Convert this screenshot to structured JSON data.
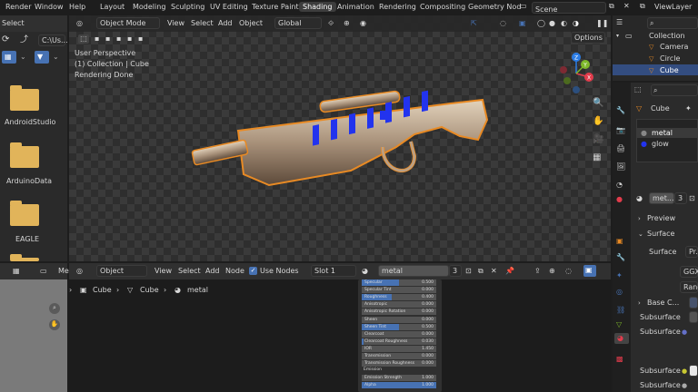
{
  "topbar": {
    "menus": [
      "Render",
      "Window",
      "Help"
    ],
    "workspaces": [
      "Layout",
      "Modeling",
      "Sculpting",
      "UV Editing",
      "Texture Paint",
      "Shading",
      "Animation",
      "Rendering",
      "Compositing",
      "Geometry Nod"
    ],
    "scene": "Scene",
    "view_layer": "ViewLayer"
  },
  "filebrowser": {
    "select_label": "Select",
    "path": "C:\\Us...",
    "folders": [
      "AndroidStudio",
      "ArduinoData",
      "EAGLE"
    ]
  },
  "viewport": {
    "mode": "Object Mode",
    "menus": [
      "View",
      "Select",
      "Add",
      "Object"
    ],
    "transform": "Global",
    "options": "Options",
    "info_line1": "User Perspective",
    "info_line2": "(1) Collection | Cube",
    "info_line3": "Rendering Done",
    "gizmo_axes": [
      "X",
      "Y",
      "Z"
    ]
  },
  "outliner": {
    "root": "Collection",
    "items": [
      "Camera",
      "Circle",
      "Cube"
    ]
  },
  "properties": {
    "object_name": "Cube",
    "materials": [
      "metal",
      "glow"
    ],
    "material_name": "met...",
    "user_count": "3",
    "preview": "Preview",
    "surface": "Surface",
    "surface_label": "Surface",
    "surface_value": "Pr...",
    "ggx": "GGX",
    "random": "Rand...",
    "base_color": "Base C...",
    "subsurface_rows": [
      "Subsurface",
      "Subsurface",
      "Subsurface",
      "Subsurface"
    ]
  },
  "node_editor": {
    "header_partial": "Me",
    "mode": "Object",
    "menus": [
      "View",
      "Select",
      "Add",
      "Node"
    ],
    "use_nodes": "Use Nodes",
    "slot": "Slot 1",
    "material": "metal",
    "users": "3",
    "breadcrumb": [
      "Cube",
      "Cube",
      "metal"
    ],
    "bsdf_params": [
      {
        "label": "Specular",
        "value": "0.500",
        "fill": 0.5
      },
      {
        "label": "Specular Tint",
        "value": "0.000",
        "fill": 0
      },
      {
        "label": "Roughness",
        "value": "0.400",
        "fill": 0.4
      },
      {
        "label": "Anisotropic",
        "value": "0.000",
        "fill": 0
      },
      {
        "label": "Anisotropic Rotation",
        "value": "0.000",
        "fill": 0
      },
      {
        "label": "Sheen",
        "value": "0.000",
        "fill": 0
      },
      {
        "label": "Sheen Tint",
        "value": "0.500",
        "fill": 0.5
      },
      {
        "label": "Clearcoat",
        "value": "0.000",
        "fill": 0
      },
      {
        "label": "Clearcoat Roughness",
        "value": "0.030",
        "fill": 0.03
      },
      {
        "label": "IOR",
        "value": "1.450",
        "fill": 0
      },
      {
        "label": "Transmission",
        "value": "0.000",
        "fill": 0
      },
      {
        "label": "Transmission Roughness",
        "value": "0.000",
        "fill": 0
      }
    ],
    "emission_label": "Emission",
    "emission_strength_label": "Emission Strength",
    "emission_strength_value": "1.000",
    "alpha_label": "Alpha",
    "alpha_value": "1.000"
  },
  "colors": {
    "accent": "#4772b3",
    "selection": "#e88a24",
    "folder": "#e1b45a",
    "glow": "#2233ee"
  }
}
